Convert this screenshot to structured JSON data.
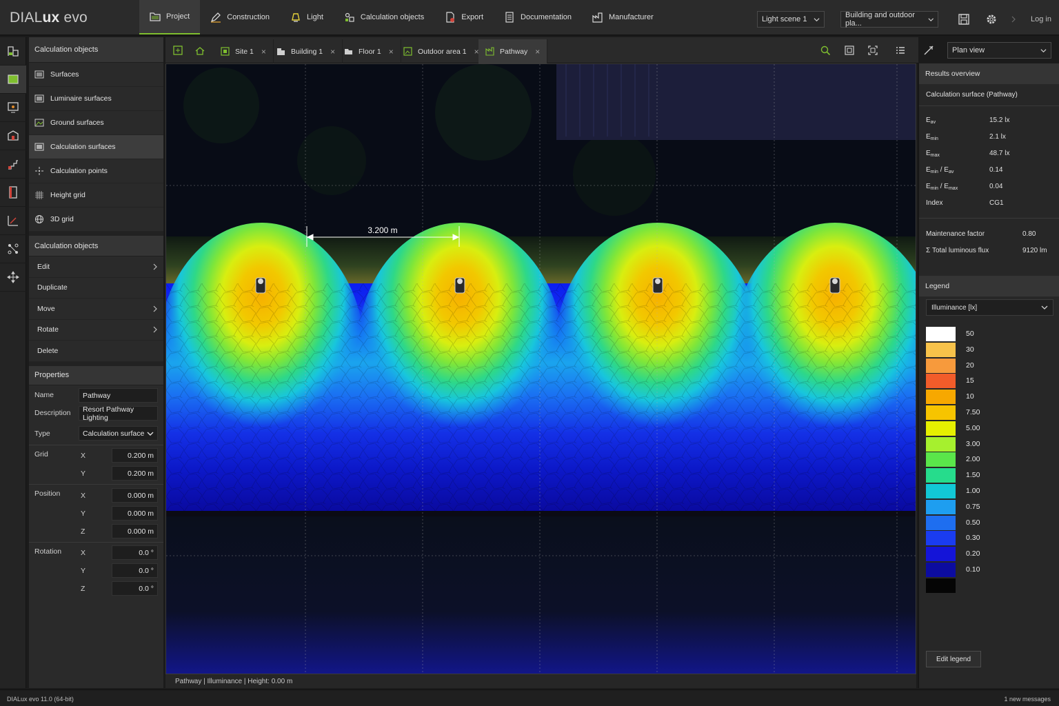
{
  "app": {
    "brand_light": "DIAL",
    "brand_bold": "ux",
    "brand_suffix": " evo"
  },
  "menu": [
    {
      "label": "Project",
      "icon": "project-folder-icon",
      "active": true
    },
    {
      "label": "Construction",
      "icon": "construction-pen-icon"
    },
    {
      "label": "Light",
      "icon": "light-bulb-icon"
    },
    {
      "label": "Calculation objects",
      "icon": "calculation-objects-icon"
    },
    {
      "label": "Export",
      "icon": "export-icon"
    },
    {
      "label": "Documentation",
      "icon": "documentation-icon"
    },
    {
      "label": "Manufacturer",
      "icon": "manufacturer-icon"
    }
  ],
  "topbar": {
    "light_scene": "Light scene 1",
    "view_scope": "Building and outdoor pla...",
    "login": "Log in",
    "save_icon": "save-icon",
    "settings_icon": "gear-icon"
  },
  "left": {
    "objects_header": "Calculation objects",
    "objects": [
      {
        "label": "Surfaces",
        "icon": "surfaces-icon"
      },
      {
        "label": "Luminaire surfaces",
        "icon": "luminaire-surfaces-icon"
      },
      {
        "label": "Ground surfaces",
        "icon": "ground-surfaces-icon"
      },
      {
        "label": "Calculation surfaces",
        "icon": "calculation-surfaces-icon",
        "selected": true
      },
      {
        "label": "Calculation points",
        "icon": "calculation-points-icon"
      },
      {
        "label": "Height grid",
        "icon": "height-grid-icon"
      },
      {
        "label": "3D grid",
        "icon": "3d-grid-icon"
      }
    ],
    "actions_header": "Calculation objects",
    "actions": [
      {
        "label": "Edit",
        "submenu": true
      },
      {
        "label": "Duplicate",
        "submenu": false
      },
      {
        "label": "Move",
        "submenu": true
      },
      {
        "label": "Rotate",
        "submenu": true
      },
      {
        "label": "Delete",
        "submenu": false
      }
    ],
    "properties_header": "Properties",
    "properties": {
      "name_label": "Name",
      "name_value": "Pathway",
      "description_label": "Description",
      "description_value": "Resort Pathway Lighting",
      "type_label": "Type",
      "type_value": "Calculation surface",
      "grid_label": "Grid",
      "grid_x_axis": "X",
      "grid_x": "0.200 m",
      "grid_y_axis": "Y",
      "grid_y": "0.200 m",
      "position_label": "Position",
      "pos_x_axis": "X",
      "pos_x": "0.000 m",
      "pos_y_axis": "Y",
      "pos_y": "0.000 m",
      "pos_z_axis": "Z",
      "pos_z": "0.000 m",
      "rotation_label": "Rotation",
      "rot_x_axis": "X",
      "rot_x": "0.0 °",
      "rot_y_axis": "Y",
      "rot_y": "0.0 °",
      "rot_z_axis": "Z",
      "rot_z": "0.0 °"
    }
  },
  "tabs": [
    {
      "label": "Site 1"
    },
    {
      "label": "Building 1"
    },
    {
      "label": "Floor 1"
    },
    {
      "label": "Outdoor area 1"
    },
    {
      "label": "Pathway",
      "active": true
    }
  ],
  "view_mode": "Plan view",
  "viewport": {
    "dimension_label": "3.200 m",
    "status": "Pathway | Illuminance | Height: 0.00 m"
  },
  "results": {
    "header": "Results overview",
    "subject": "Calculation surface (Pathway)",
    "e_av": "15.2 lx",
    "e_min": "2.1 lx",
    "e_max": "48.7 lx",
    "uniformity_1": "0.14",
    "uniformity_2": "0.04",
    "index_label": "Index",
    "index": "CG1",
    "maintenance_label": "Maintenance factor",
    "maintenance": "0.80",
    "flux_label": "Total luminous flux",
    "flux": "9120 lm"
  },
  "legend": {
    "header": "Legend",
    "quantity": "Illuminance [lx]",
    "entries": [
      {
        "value": "50",
        "color": "#ffffff"
      },
      {
        "value": "30",
        "color": "#f7c24a"
      },
      {
        "value": "20",
        "color": "#f79a3c"
      },
      {
        "value": "15",
        "color": "#f25c2a"
      },
      {
        "value": "10",
        "color": "#f7a800"
      },
      {
        "value": "7.50",
        "color": "#f7c400"
      },
      {
        "value": "5.00",
        "color": "#e6f000"
      },
      {
        "value": "3.00",
        "color": "#a6f02e"
      },
      {
        "value": "2.00",
        "color": "#5ae64a"
      },
      {
        "value": "1.50",
        "color": "#26dc8c"
      },
      {
        "value": "1.00",
        "color": "#12c8d6"
      },
      {
        "value": "0.75",
        "color": "#1e9ef0"
      },
      {
        "value": "0.50",
        "color": "#1e6ef0"
      },
      {
        "value": "0.30",
        "color": "#1a3cf0"
      },
      {
        "value": "0.20",
        "color": "#1414d8"
      },
      {
        "value": "0.10",
        "color": "#0c0ca0"
      },
      {
        "value": "",
        "color": "#050505"
      }
    ],
    "edit_button": "Edit legend"
  },
  "footer": {
    "version": "DIALux evo 11.0 (64-bit)",
    "messages": "1 new messages"
  }
}
